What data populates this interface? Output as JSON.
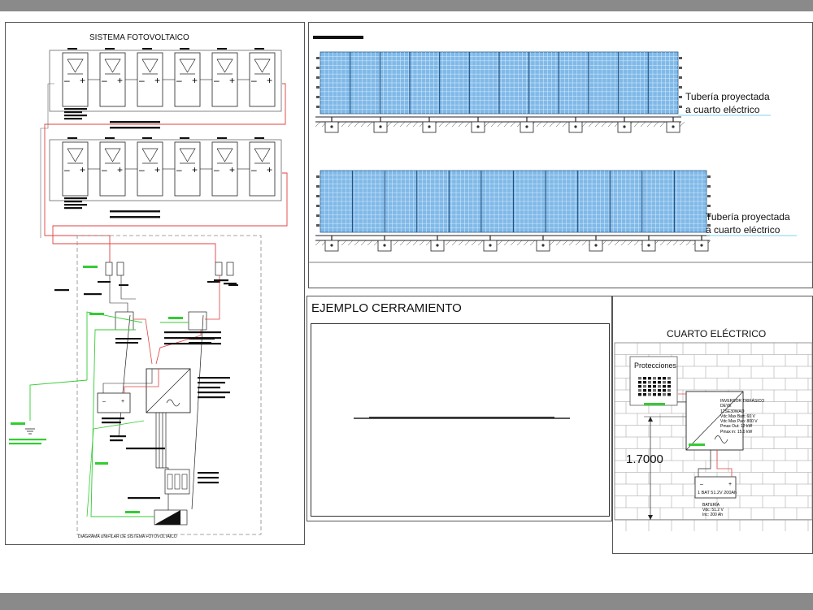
{
  "sistema": {
    "title": "SISTEMA FOTOVOLTAICO",
    "caption": "DIAGRAMA UNIFILAR DE SISTEMA FOTOVOLTAICO"
  },
  "elevacion": {
    "pipe_label_1_line1": "Tubería proyectada",
    "pipe_label_1_line2": "a cuarto eléctrico",
    "pipe_label_2_line1": "Tubería proyectada",
    "pipe_label_2_line2": "a cuarto eléctrico"
  },
  "cerramiento": {
    "title": "EJEMPLO CERRAMIENTO"
  },
  "cuarto": {
    "title": "CUARTO ELÉCTRICO",
    "protecciones": "Protecciones",
    "height_dim": "1.7000",
    "inverter_lines": [
      "INVERSOR TRIFÁSICO",
      "DEYE",
      "12SE30WAO",
      "Vdc Max Batt: 60 V",
      "Vdc Max Pan: 800 V",
      "Pmax Out: 12 kW",
      "Pmax in: 15.6 kW"
    ],
    "battery_label": "1 BAT 51.2V 200Ah",
    "battery_lines": [
      "BATERÍA",
      "Vdc: 51.2 V",
      "Inc: 200 Ah"
    ]
  },
  "colors": {
    "panel_blue": "#7fb9e8",
    "wire_red": "#e04040",
    "wire_green": "#33cc33",
    "accent_cyan": "#55c8e8"
  }
}
